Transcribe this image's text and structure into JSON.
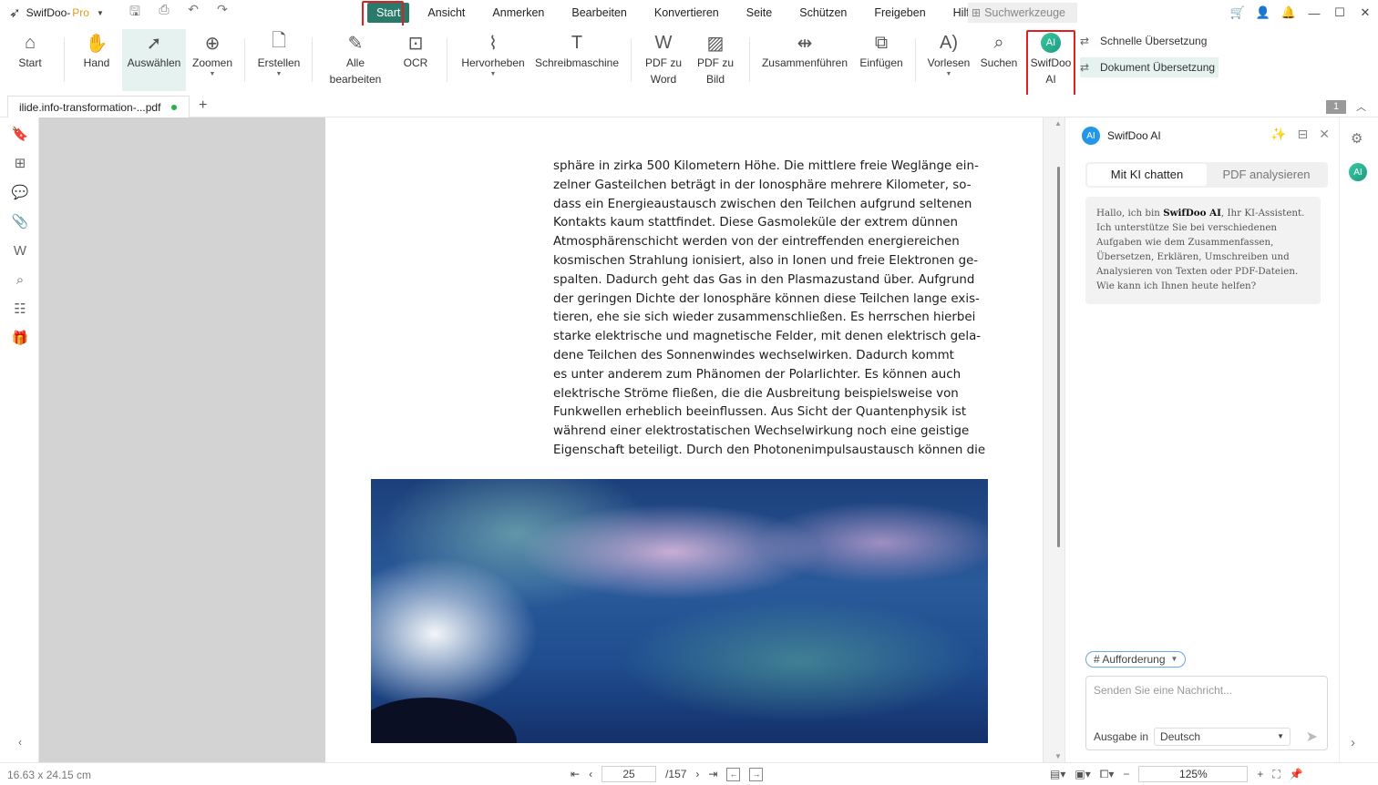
{
  "app": {
    "name": "SwifDoo-",
    "edition": "Pro"
  },
  "menu": [
    "Start",
    "Ansicht",
    "Anmerken",
    "Bearbeiten",
    "Konvertieren",
    "Seite",
    "Schützen",
    "Freigeben",
    "Hilfe"
  ],
  "search_tools": "Suchwerkzeuge",
  "ribbon": {
    "start": "Start",
    "hand": "Hand",
    "select": "Auswählen",
    "zoom": "Zoomen",
    "create": "Erstellen",
    "edit_all_1": "Alle",
    "edit_all_2": "bearbeiten",
    "ocr": "OCR",
    "highlight": "Hervorheben",
    "typewriter": "Schreibmaschine",
    "pdf_word_1": "PDF zu",
    "pdf_word_2": "Word",
    "pdf_img_1": "PDF zu",
    "pdf_img_2": "Bild",
    "merge": "Zusammenführen",
    "insert": "Einfügen",
    "read": "Vorlesen",
    "search": "Suchen",
    "ai_1": "SwifDoo",
    "ai_2": "AI",
    "quick_translate": "Schnelle Übersetzung",
    "doc_translate": "Dokument Übersetzung"
  },
  "tab": {
    "filename": "ilide.info-transformation-...pdf",
    "page_badge": "1"
  },
  "document": {
    "lines": [
      "sphäre in zirka 500 Kilometern Höhe. Die mittlere freie Weglänge ein-",
      "zelner Gasteilchen beträgt in der Ionosphäre mehrere Kilometer, so-",
      "dass ein Energieaustausch zwischen den Teilchen aufgrund seltenen",
      "Kontakts kaum stattfindet. Diese Gasmoleküle der extrem dünnen",
      "Atmosphärenschicht werden von der eintreffenden energiereichen",
      "kosmischen Strahlung ionisiert, also in Ionen und freie Elektronen ge-",
      "spalten. Dadurch geht das Gas in den Plasmazustand über. Aufgrund",
      "der geringen Dichte der Ionosphäre können diese Teilchen lange exis-",
      "tieren, ehe sie sich wieder zusammenschließen. Es herrschen hierbei",
      "starke elektrische und magnetische Felder, mit denen elektrisch gela-",
      "dene Teilchen des Sonnenwindes wechselwirken. Dadurch kommt",
      "es unter anderem zum Phänomen der Polarlichter. Es können auch",
      "elektrische Ströme fließen, die die Ausbreitung beispielsweise von",
      "Funkwellen erheblich beeinflussen. Aus Sicht der Quantenphysik ist",
      "während einer elektrostatischen Wechselwirkung noch eine geistige",
      "Eigenschaft beteiligt. Durch den Photonenimpulsaustausch können die"
    ]
  },
  "ai_panel": {
    "title": "SwifDoo AI",
    "tab_chat": "Mit KI chatten",
    "tab_analyze": "PDF analysieren",
    "greeting_pre": "Hallo, ich bin ",
    "greeting_name": "SwifDoo AI",
    "greeting_post": ", Ihr KI-Assistent. Ich unterstütze Sie bei verschiedenen Aufgaben wie dem Zusammenfassen, Übersetzen, Erklären, Umschreiben und Analysieren von Texten oder PDF-Dateien. Wie kann ich Ihnen heute helfen?",
    "prompt_chip": "# Aufforderung",
    "placeholder": "Senden Sie eine Nachricht...",
    "output_label": "Ausgabe in",
    "output_lang": "Deutsch"
  },
  "status": {
    "dims": "16.63 x 24.15 cm",
    "page": "25",
    "total": "/157",
    "zoom": "125%"
  }
}
